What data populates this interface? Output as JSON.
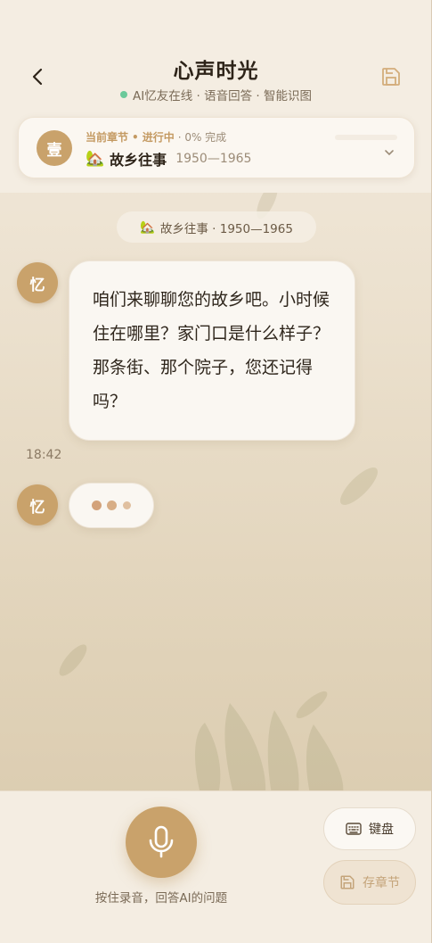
{
  "header": {
    "title": "心声时光",
    "status": "AI忆友在线 · 语音回答 · 智能识图"
  },
  "chapter": {
    "badge": "壹",
    "label": "当前章节",
    "separator": "•",
    "status": "进行中",
    "progress_text": "· 0% 完成",
    "progress": 0,
    "emoji": "🏡",
    "name": "故乡往事",
    "years": "1950—1965"
  },
  "chat": {
    "date_pill": {
      "emoji": "🏡",
      "text": "故乡往事 · 1950—1965"
    },
    "messages": [
      {
        "avatar": "忆",
        "text": "咱们来聊聊您的故乡吧。小时候住在哪里？家门口是什么样子？那条街、那个院子，您还记得吗？",
        "time": "18:42"
      }
    ],
    "typing": {
      "avatar": "忆"
    }
  },
  "bottom": {
    "hint": "按住录音，回答AI的问题",
    "keyboard_label": "键盘",
    "save_chapter_label": "存章节"
  },
  "colors": {
    "accent": "#c9a26b",
    "online": "#6bc99a",
    "text_dark": "#2e2419",
    "text_muted": "#7a6a56"
  }
}
